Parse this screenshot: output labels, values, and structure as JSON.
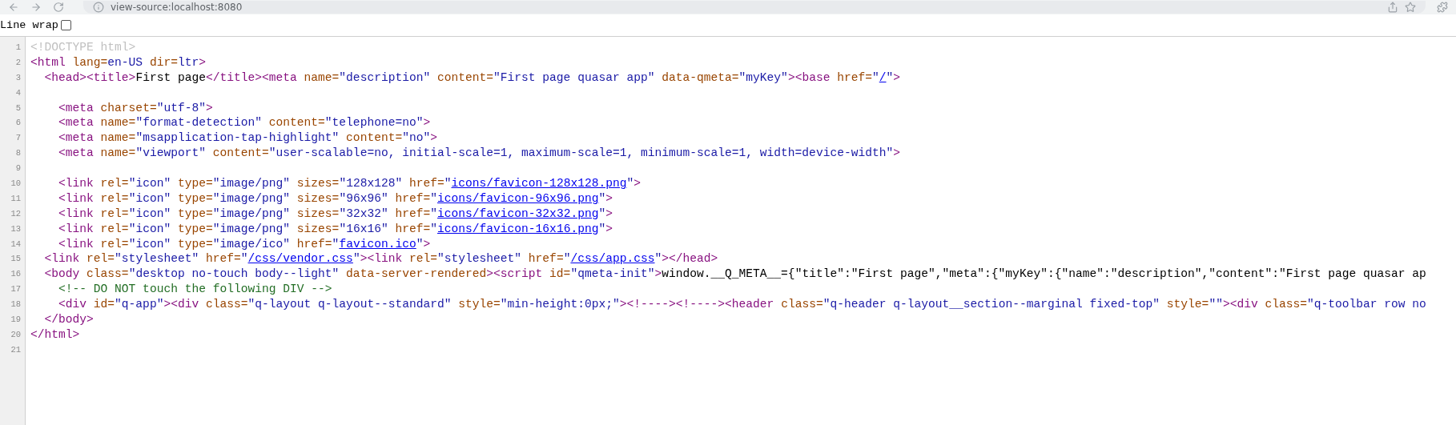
{
  "browser": {
    "url": "view-source:localhost:8080"
  },
  "line_wrap": {
    "label": "Line wrap",
    "checked": false
  },
  "lines": [
    {
      "number": "1",
      "tokens": [
        {
          "kind": "doctype",
          "text": "<!DOCTYPE html>"
        }
      ]
    },
    {
      "number": "2",
      "tokens": [
        {
          "kind": "tag",
          "text": "<html"
        },
        {
          "kind": "attr",
          "text": " lang="
        },
        {
          "kind": "value",
          "text": "en-US"
        },
        {
          "kind": "attr",
          "text": " dir="
        },
        {
          "kind": "value",
          "text": "ltr"
        },
        {
          "kind": "tag",
          "text": ">"
        }
      ]
    },
    {
      "number": "3",
      "tokens": [
        {
          "kind": "tag",
          "text": "  <head><title>"
        },
        {
          "kind": "text",
          "text": "First page"
        },
        {
          "kind": "tag",
          "text": "</title><meta"
        },
        {
          "kind": "attr",
          "text": " name="
        },
        {
          "kind": "value",
          "text": "\"description\""
        },
        {
          "kind": "attr",
          "text": " content="
        },
        {
          "kind": "value",
          "text": "\"First page quasar app\""
        },
        {
          "kind": "attr",
          "text": " data-qmeta="
        },
        {
          "kind": "value",
          "text": "\"myKey\""
        },
        {
          "kind": "tag",
          "text": "><base"
        },
        {
          "kind": "attr",
          "text": " href="
        },
        {
          "kind": "value",
          "text": "\""
        },
        {
          "kind": "link",
          "text": "/"
        },
        {
          "kind": "value",
          "text": "\""
        },
        {
          "kind": "tag",
          "text": ">"
        }
      ]
    },
    {
      "number": "4"
    },
    {
      "number": "5",
      "tokens": [
        {
          "kind": "tag",
          "text": "    <meta"
        },
        {
          "kind": "attr",
          "text": " charset="
        },
        {
          "kind": "value",
          "text": "\"utf-8\""
        },
        {
          "kind": "tag",
          "text": ">"
        }
      ]
    },
    {
      "number": "6",
      "tokens": [
        {
          "kind": "tag",
          "text": "    <meta"
        },
        {
          "kind": "attr",
          "text": " name="
        },
        {
          "kind": "value",
          "text": "\"format-detection\""
        },
        {
          "kind": "attr",
          "text": " content="
        },
        {
          "kind": "value",
          "text": "\"telephone=no\""
        },
        {
          "kind": "tag",
          "text": ">"
        }
      ]
    },
    {
      "number": "7",
      "tokens": [
        {
          "kind": "tag",
          "text": "    <meta"
        },
        {
          "kind": "attr",
          "text": " name="
        },
        {
          "kind": "value",
          "text": "\"msapplication-tap-highlight\""
        },
        {
          "kind": "attr",
          "text": " content="
        },
        {
          "kind": "value",
          "text": "\"no\""
        },
        {
          "kind": "tag",
          "text": ">"
        }
      ]
    },
    {
      "number": "8",
      "tokens": [
        {
          "kind": "tag",
          "text": "    <meta"
        },
        {
          "kind": "attr",
          "text": " name="
        },
        {
          "kind": "value",
          "text": "\"viewport\""
        },
        {
          "kind": "attr",
          "text": " content="
        },
        {
          "kind": "value",
          "text": "\"user-scalable=no, initial-scale=1, maximum-scale=1, minimum-scale=1, width=device-width\""
        },
        {
          "kind": "tag",
          "text": ">"
        }
      ]
    },
    {
      "number": "9"
    },
    {
      "number": "10",
      "tokens": [
        {
          "kind": "tag",
          "text": "    <link"
        },
        {
          "kind": "attr",
          "text": " rel="
        },
        {
          "kind": "value",
          "text": "\"icon\""
        },
        {
          "kind": "attr",
          "text": " type="
        },
        {
          "kind": "value",
          "text": "\"image/png\""
        },
        {
          "kind": "attr",
          "text": " sizes="
        },
        {
          "kind": "value",
          "text": "\"128x128\""
        },
        {
          "kind": "attr",
          "text": " href="
        },
        {
          "kind": "value",
          "text": "\""
        },
        {
          "kind": "link",
          "text": "icons/favicon-128x128.png"
        },
        {
          "kind": "value",
          "text": "\""
        },
        {
          "kind": "tag",
          "text": ">"
        }
      ]
    },
    {
      "number": "11",
      "tokens": [
        {
          "kind": "tag",
          "text": "    <link"
        },
        {
          "kind": "attr",
          "text": " rel="
        },
        {
          "kind": "value",
          "text": "\"icon\""
        },
        {
          "kind": "attr",
          "text": " type="
        },
        {
          "kind": "value",
          "text": "\"image/png\""
        },
        {
          "kind": "attr",
          "text": " sizes="
        },
        {
          "kind": "value",
          "text": "\"96x96\""
        },
        {
          "kind": "attr",
          "text": " href="
        },
        {
          "kind": "value",
          "text": "\""
        },
        {
          "kind": "link",
          "text": "icons/favicon-96x96.png"
        },
        {
          "kind": "value",
          "text": "\""
        },
        {
          "kind": "tag",
          "text": ">"
        }
      ]
    },
    {
      "number": "12",
      "tokens": [
        {
          "kind": "tag",
          "text": "    <link"
        },
        {
          "kind": "attr",
          "text": " rel="
        },
        {
          "kind": "value",
          "text": "\"icon\""
        },
        {
          "kind": "attr",
          "text": " type="
        },
        {
          "kind": "value",
          "text": "\"image/png\""
        },
        {
          "kind": "attr",
          "text": " sizes="
        },
        {
          "kind": "value",
          "text": "\"32x32\""
        },
        {
          "kind": "attr",
          "text": " href="
        },
        {
          "kind": "value",
          "text": "\""
        },
        {
          "kind": "link",
          "text": "icons/favicon-32x32.png"
        },
        {
          "kind": "value",
          "text": "\""
        },
        {
          "kind": "tag",
          "text": ">"
        }
      ]
    },
    {
      "number": "13",
      "tokens": [
        {
          "kind": "tag",
          "text": "    <link"
        },
        {
          "kind": "attr",
          "text": " rel="
        },
        {
          "kind": "value",
          "text": "\"icon\""
        },
        {
          "kind": "attr",
          "text": " type="
        },
        {
          "kind": "value",
          "text": "\"image/png\""
        },
        {
          "kind": "attr",
          "text": " sizes="
        },
        {
          "kind": "value",
          "text": "\"16x16\""
        },
        {
          "kind": "attr",
          "text": " href="
        },
        {
          "kind": "value",
          "text": "\""
        },
        {
          "kind": "link",
          "text": "icons/favicon-16x16.png"
        },
        {
          "kind": "value",
          "text": "\""
        },
        {
          "kind": "tag",
          "text": ">"
        }
      ]
    },
    {
      "number": "14",
      "tokens": [
        {
          "kind": "tag",
          "text": "    <link"
        },
        {
          "kind": "attr",
          "text": " rel="
        },
        {
          "kind": "value",
          "text": "\"icon\""
        },
        {
          "kind": "attr",
          "text": " type="
        },
        {
          "kind": "value",
          "text": "\"image/ico\""
        },
        {
          "kind": "attr",
          "text": " href="
        },
        {
          "kind": "value",
          "text": "\""
        },
        {
          "kind": "link",
          "text": "favicon.ico"
        },
        {
          "kind": "value",
          "text": "\""
        },
        {
          "kind": "tag",
          "text": ">"
        }
      ]
    },
    {
      "number": "15",
      "tokens": [
        {
          "kind": "tag",
          "text": "  <link"
        },
        {
          "kind": "attr",
          "text": " rel="
        },
        {
          "kind": "value",
          "text": "\"stylesheet\""
        },
        {
          "kind": "attr",
          "text": " href="
        },
        {
          "kind": "value",
          "text": "\""
        },
        {
          "kind": "link",
          "text": "/css/vendor.css"
        },
        {
          "kind": "value",
          "text": "\""
        },
        {
          "kind": "tag",
          "text": "><link"
        },
        {
          "kind": "attr",
          "text": " rel="
        },
        {
          "kind": "value",
          "text": "\"stylesheet\""
        },
        {
          "kind": "attr",
          "text": " href="
        },
        {
          "kind": "value",
          "text": "\""
        },
        {
          "kind": "link",
          "text": "/css/app.css"
        },
        {
          "kind": "value",
          "text": "\""
        },
        {
          "kind": "tag",
          "text": "></head>"
        }
      ]
    },
    {
      "number": "16",
      "tokens": [
        {
          "kind": "tag",
          "text": "  <body"
        },
        {
          "kind": "attr",
          "text": " class="
        },
        {
          "kind": "value",
          "text": "\"desktop no-touch body--light\""
        },
        {
          "kind": "attr",
          "text": " data-server-rendered"
        },
        {
          "kind": "tag",
          "text": "><script"
        },
        {
          "kind": "attr",
          "text": " id="
        },
        {
          "kind": "value",
          "text": "\"qmeta-init\""
        },
        {
          "kind": "tag",
          "text": ">"
        },
        {
          "kind": "text",
          "text": "window.__Q_META__={\"title\":\"First page\",\"meta\":{\"myKey\":{\"name\":\"description\",\"content\":\"First page quasar ap"
        }
      ]
    },
    {
      "number": "17",
      "tokens": [
        {
          "kind": "comment",
          "text": "    <!-- DO NOT touch the following DIV -->"
        }
      ]
    },
    {
      "number": "18",
      "tokens": [
        {
          "kind": "tag",
          "text": "    <div"
        },
        {
          "kind": "attr",
          "text": " id="
        },
        {
          "kind": "value",
          "text": "\"q-app\""
        },
        {
          "kind": "tag",
          "text": "><div"
        },
        {
          "kind": "attr",
          "text": " class="
        },
        {
          "kind": "value",
          "text": "\"q-layout q-layout--standard\""
        },
        {
          "kind": "attr",
          "text": " style="
        },
        {
          "kind": "value",
          "text": "\"min-height:0px;\""
        },
        {
          "kind": "tag",
          "text": "><!----><!----><header"
        },
        {
          "kind": "attr",
          "text": " class="
        },
        {
          "kind": "value",
          "text": "\"q-header q-layout__section--marginal fixed-top\""
        },
        {
          "kind": "attr",
          "text": " style="
        },
        {
          "kind": "value",
          "text": "\"\""
        },
        {
          "kind": "tag",
          "text": "><div"
        },
        {
          "kind": "attr",
          "text": " class="
        },
        {
          "kind": "value",
          "text": "\"q-toolbar row no"
        }
      ]
    },
    {
      "number": "19",
      "tokens": [
        {
          "kind": "tag",
          "text": "  </body>"
        }
      ]
    },
    {
      "number": "20",
      "tokens": [
        {
          "kind": "tag",
          "text": "</html>"
        }
      ]
    },
    {
      "number": "21"
    }
  ]
}
